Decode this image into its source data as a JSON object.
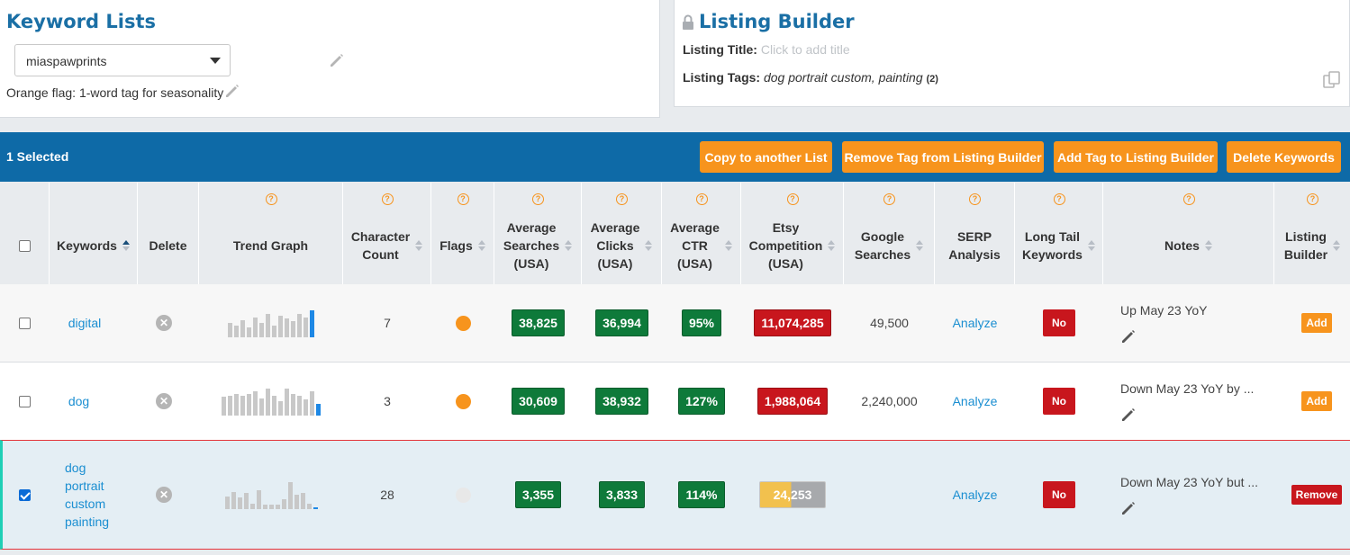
{
  "keyword_lists": {
    "title": "Keyword Lists",
    "selected_list": "miaspawprints",
    "note": "Orange flag: 1-word tag for seasonality"
  },
  "listing_builder": {
    "title": "Listing Builder",
    "title_label": "Listing Title:",
    "title_placeholder": "Click to add title",
    "tags_label": "Listing Tags:",
    "tags_value": "dog portrait custom, painting",
    "tags_count": "(2)"
  },
  "action_bar": {
    "selected_count": "1 Selected",
    "buttons": [
      "Copy to another List",
      "Remove Tag from Listing Builder",
      "Add Tag to Listing Builder",
      "Delete Keywords"
    ]
  },
  "columns": {
    "keywords": "Keywords",
    "delete": "Delete",
    "trend": "Trend Graph",
    "char_line1": "Character",
    "char_line2": "Count",
    "flags": "Flags",
    "avg_searches_1": "Average",
    "avg_searches_2": "Searches",
    "avg_searches_3": "(USA)",
    "avg_clicks_1": "Average",
    "avg_clicks_2": "Clicks",
    "avg_clicks_3": "(USA)",
    "avg_ctr_1": "Average",
    "avg_ctr_2": "CTR",
    "avg_ctr_3": "(USA)",
    "etsy_1": "Etsy",
    "etsy_2": "Competition",
    "etsy_3": "(USA)",
    "google_1": "Google",
    "google_2": "Searches",
    "serp_1": "SERP",
    "serp_2": "Analysis",
    "longtail_1": "Long Tail",
    "longtail_2": "Keywords",
    "notes": "Notes",
    "lb_1": "Listing",
    "lb_2": "Builder",
    "help": "?"
  },
  "rows": [
    {
      "keyword": "digital",
      "checked": false,
      "trend": [
        0.5,
        0.4,
        0.6,
        0.35,
        0.7,
        0.5,
        0.8,
        0.4,
        0.75,
        0.65,
        0.55,
        0.8,
        0.7,
        0.95
      ],
      "char_count": "7",
      "flag": "orange",
      "avg_searches": "38,825",
      "avg_clicks": "36,994",
      "avg_ctr": "95%",
      "etsy_competition": "11,074,285",
      "google_searches": "49,500",
      "serp": "Analyze",
      "long_tail": "No",
      "notes": "Up May 23 YoY",
      "lb_action": "Add"
    },
    {
      "keyword": "dog",
      "checked": false,
      "trend": [
        0.65,
        0.7,
        0.75,
        0.7,
        0.75,
        0.85,
        0.6,
        0.95,
        0.7,
        0.5,
        0.95,
        0.75,
        0.7,
        0.55,
        0.85,
        0.4
      ],
      "char_count": "3",
      "flag": "orange",
      "avg_searches": "30,609",
      "avg_clicks": "38,932",
      "avg_ctr": "127%",
      "etsy_competition": "1,988,064",
      "google_searches": "2,240,000",
      "serp": "Analyze",
      "long_tail": "No",
      "notes": "Down May 23 YoY by ...",
      "lb_action": "Add"
    },
    {
      "keyword_line1": "dog",
      "keyword_line2": "portrait",
      "keyword_line3": "custom",
      "keyword_line4": "painting",
      "checked": true,
      "trend": [
        0.45,
        0.6,
        0.4,
        0.55,
        0.2,
        0.65,
        0.15,
        0.15,
        0.15,
        0.35,
        0.95,
        0.5,
        0.55,
        0.2,
        0.05
      ],
      "char_count": "28",
      "flag": "none",
      "avg_searches": "3,355",
      "avg_clicks": "3,833",
      "avg_ctr": "114%",
      "etsy_competition": "24,253",
      "google_searches": "",
      "serp": "Analyze",
      "long_tail": "No",
      "notes": "Down May 23 YoY but ...",
      "lb_action": "Remove"
    }
  ],
  "colors": {
    "header_blue": "#0e6aa7",
    "action_orange": "#f7941d",
    "good_green": "#0e7a3a",
    "bad_red": "#c8161d",
    "link_blue": "#1a8ed1"
  }
}
